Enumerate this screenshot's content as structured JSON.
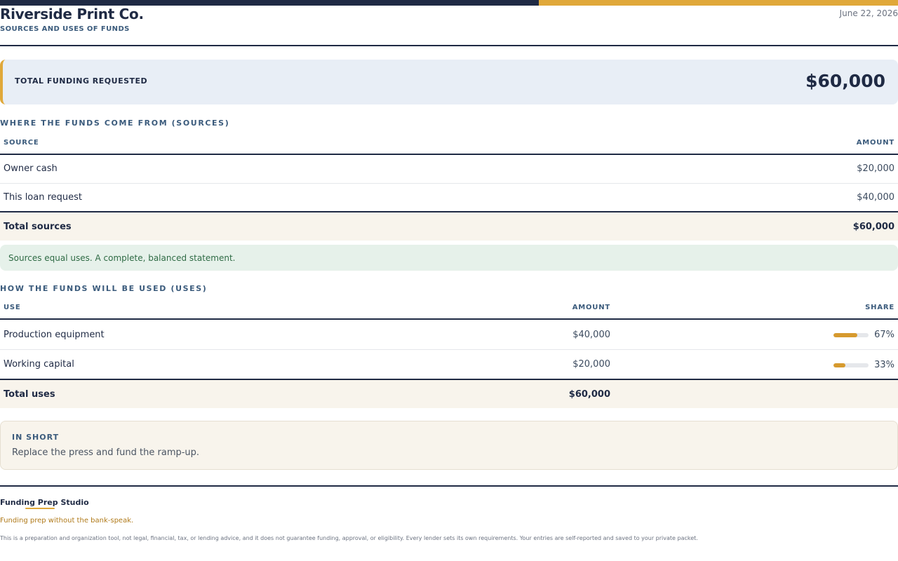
{
  "header": {
    "company": "Riverside Print Co.",
    "subtitle": "SOURCES AND USES OF FUNDS",
    "date": "June 22, 2026"
  },
  "colors": {
    "navy": "#1f2a44",
    "gold": "#e0a83a",
    "success_bg": "#e6f1ea",
    "success_text": "#2f6b45"
  },
  "total_funding": {
    "label": "TOTAL FUNDING REQUESTED",
    "value": "$60,000"
  },
  "sources": {
    "title": "WHERE THE FUNDS COME FROM (SOURCES)",
    "col_source": "SOURCE",
    "col_amount": "AMOUNT",
    "rows": [
      {
        "name": "Owner cash",
        "amount": "$20,000"
      },
      {
        "name": "This loan request",
        "amount": "$40,000"
      }
    ],
    "total_label": "Total sources",
    "total_amount": "$60,000"
  },
  "balance_note": "Sources equal uses. A complete, balanced statement.",
  "uses": {
    "title": "HOW THE FUNDS WILL BE USED (USES)",
    "col_use": "USE",
    "col_amount": "AMOUNT",
    "col_share": "SHARE",
    "rows": [
      {
        "name": "Production equipment",
        "amount": "$40,000",
        "share": "67%",
        "share_value": 0.67
      },
      {
        "name": "Working capital",
        "amount": "$20,000",
        "share": "33%",
        "share_value": 0.33
      }
    ],
    "total_label": "Total uses",
    "total_amount": "$60,000"
  },
  "in_short": {
    "label": "IN SHORT",
    "text": "Replace the press and fund the ramp-up."
  },
  "footer": {
    "brand": "Funding Prep Studio",
    "tagline": "Funding prep without the bank-speak.",
    "disclaimer": "This is a preparation and organization tool, not legal, financial, tax, or lending advice, and it does not guarantee funding, approval, or eligibility. Every lender sets its own requirements. Your entries are self-reported and saved to your private packet."
  }
}
